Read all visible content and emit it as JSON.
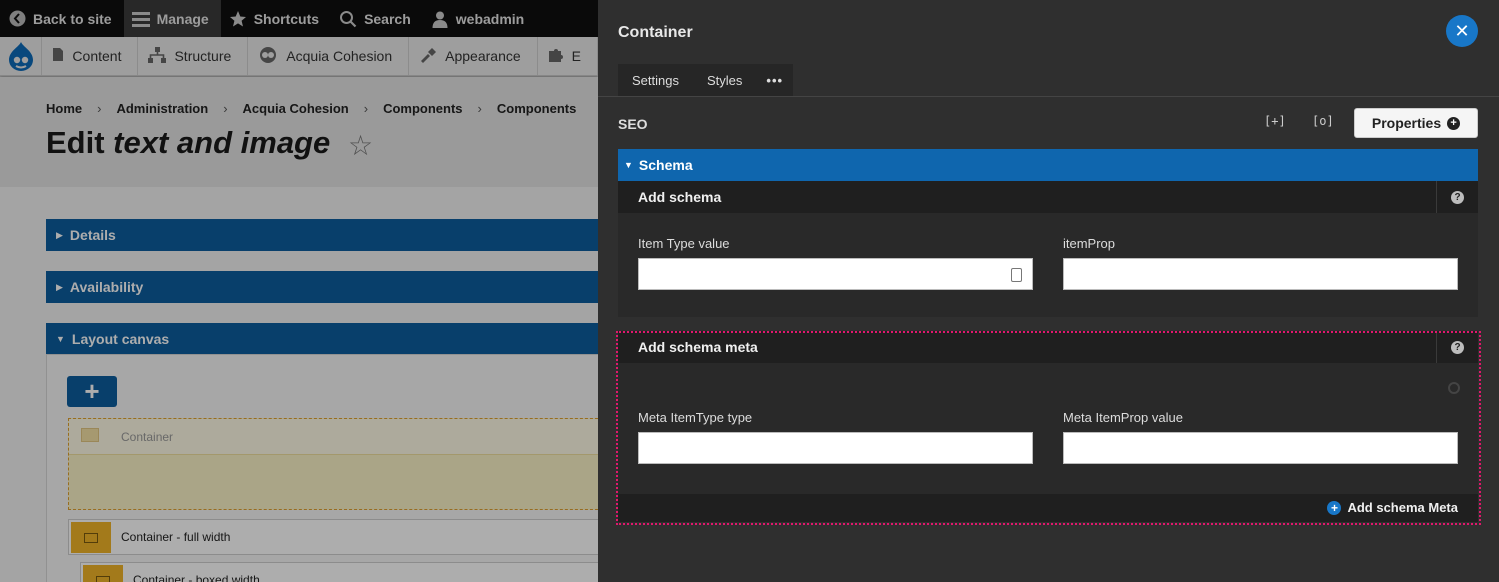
{
  "toolbar": {
    "back": "Back to site",
    "manage": "Manage",
    "shortcuts": "Shortcuts",
    "search": "Search",
    "user": "webadmin"
  },
  "menu": {
    "content": "Content",
    "structure": "Structure",
    "cohesion": "Acquia Cohesion",
    "appearance": "Appearance",
    "extend": "E"
  },
  "breadcrumb": [
    "Home",
    "Administration",
    "Acquia Cohesion",
    "Components",
    "Components"
  ],
  "page": {
    "title_prefix": "Edit ",
    "title_em": "text and image",
    "star": "☆"
  },
  "accordions": {
    "details": "Details",
    "availability": "Availability",
    "layout_canvas": "Layout canvas"
  },
  "canvas": {
    "add_symbol": "+",
    "container": "Container",
    "full_width": "Container - full width",
    "boxed_width": "Container - boxed width"
  },
  "panel": {
    "title": "Container",
    "close_symbol": "✕",
    "tabs": [
      "Settings",
      "Styles",
      "•••"
    ],
    "seo_label": "SEO",
    "icon_expand": "[+]",
    "icon_search": "[o]",
    "properties_label": "Properties",
    "schema_label": "Schema",
    "add_schema": {
      "title": "Add schema",
      "item_type_label": "Item Type value",
      "item_type_value": "",
      "itemprop_label": "itemProp",
      "itemprop_value": ""
    },
    "add_schema_meta": {
      "title": "Add schema meta",
      "meta_itemtype_label": "Meta ItemType type",
      "meta_itemtype_value": "",
      "meta_itemprop_label": "Meta ItemProp value",
      "meta_itemprop_value": "",
      "add_button": "Add schema Meta"
    },
    "colors": {
      "accent": "#0f66ae",
      "close": "#1877c8",
      "highlight_outline": "#e0186c"
    }
  }
}
